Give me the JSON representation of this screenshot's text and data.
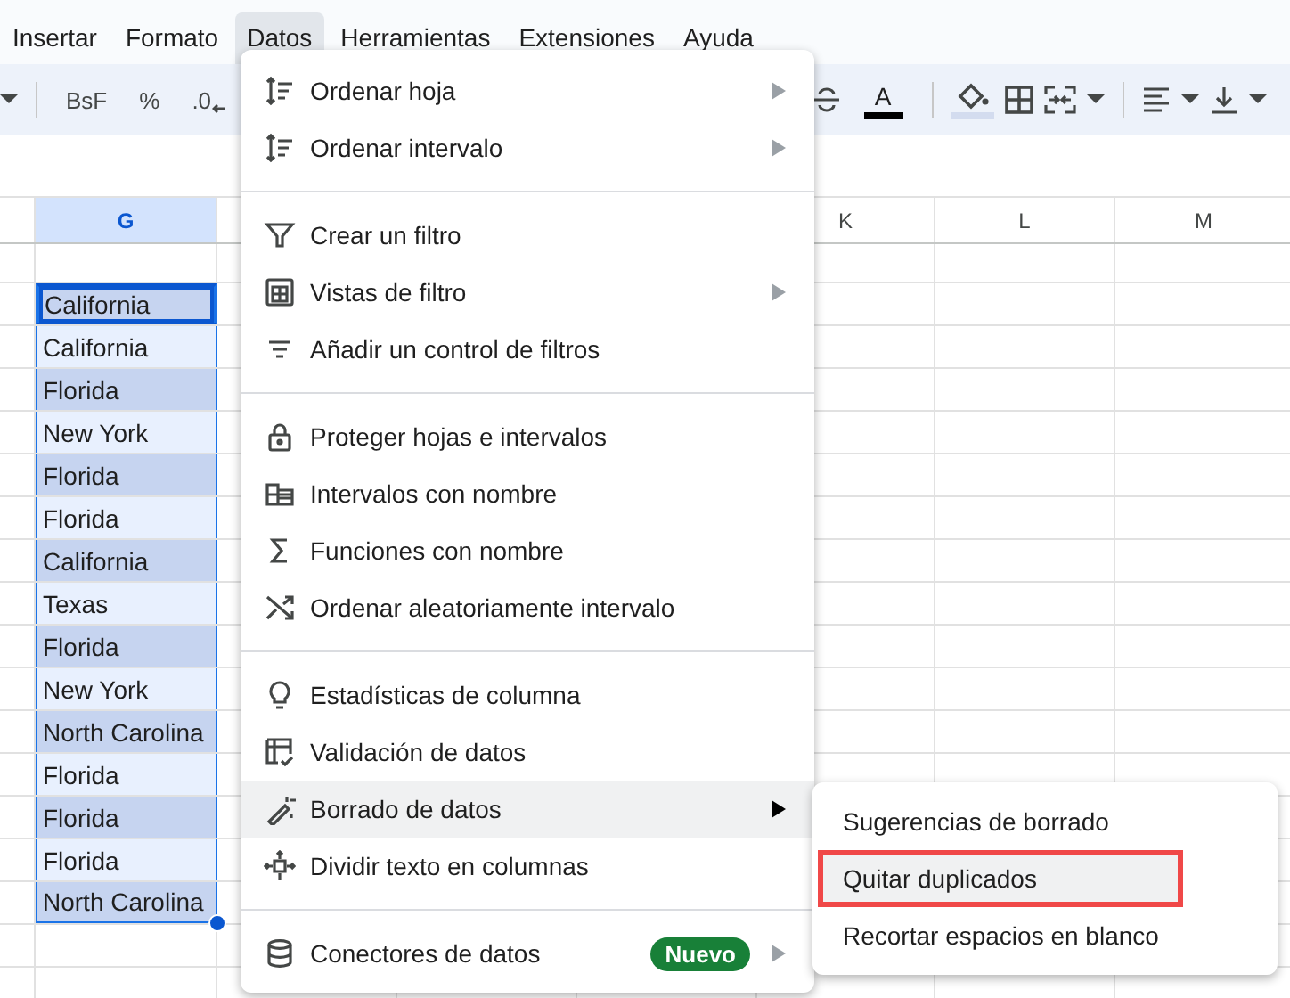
{
  "menu_bar": [
    {
      "label": "Insertar",
      "selected": false
    },
    {
      "label": "Formato",
      "selected": false
    },
    {
      "label": "Datos",
      "selected": true
    },
    {
      "label": "Herramientas",
      "selected": false
    },
    {
      "label": "Extensiones",
      "selected": false
    },
    {
      "label": "Ayuda",
      "selected": false
    }
  ],
  "toolbar_left": [
    {
      "kind": "caret"
    },
    {
      "kind": "divider"
    },
    {
      "kind": "text",
      "label": "BsF"
    },
    {
      "kind": "text",
      "label": "%"
    },
    {
      "kind": "decimal",
      "label": ".0"
    }
  ],
  "toolbar_right": [
    {
      "kind": "strikethrough"
    },
    {
      "kind": "text-color",
      "label": "A"
    },
    {
      "kind": "divider"
    },
    {
      "kind": "fill"
    },
    {
      "kind": "borders"
    },
    {
      "kind": "merge"
    },
    {
      "kind": "caret"
    },
    {
      "kind": "divider"
    },
    {
      "kind": "align"
    },
    {
      "kind": "caret"
    },
    {
      "kind": "valign"
    },
    {
      "kind": "caret"
    }
  ],
  "column_headers": [
    {
      "label": "G",
      "selected": true
    },
    {
      "label": "K",
      "selected": false
    },
    {
      "label": "L",
      "selected": false
    },
    {
      "label": "M",
      "selected": false
    }
  ],
  "cells": [
    {
      "text": "California",
      "active": true
    },
    {
      "text": "California",
      "active": false
    },
    {
      "text": "Florida",
      "active": false
    },
    {
      "text": "New York",
      "active": false
    },
    {
      "text": "Florida",
      "active": false
    },
    {
      "text": "Florida",
      "active": false
    },
    {
      "text": "California",
      "active": false
    },
    {
      "text": "Texas",
      "active": false
    },
    {
      "text": "Florida",
      "active": false
    },
    {
      "text": "New York",
      "active": false
    },
    {
      "text": "North Carolina",
      "active": false
    },
    {
      "text": "Florida",
      "active": false
    },
    {
      "text": "Florida",
      "active": false
    },
    {
      "text": "Florida",
      "active": false
    },
    {
      "text": "North Carolina",
      "active": false
    }
  ],
  "data_menu": {
    "groups": [
      [
        {
          "label": "Ordenar hoja",
          "submenu": true,
          "hovered": false
        },
        {
          "label": "Ordenar intervalo",
          "submenu": true,
          "hovered": false
        }
      ],
      [
        {
          "label": "Crear un filtro",
          "submenu": false,
          "hovered": false
        },
        {
          "label": "Vistas de filtro",
          "submenu": true,
          "hovered": false
        },
        {
          "label": "Añadir un control de filtros",
          "submenu": false,
          "hovered": false
        }
      ],
      [
        {
          "label": "Proteger hojas e intervalos",
          "submenu": false,
          "hovered": false
        },
        {
          "label": "Intervalos con nombre",
          "submenu": false,
          "hovered": false
        },
        {
          "label": "Funciones con nombre",
          "submenu": false,
          "hovered": false
        },
        {
          "label": "Ordenar aleatoriamente intervalo",
          "submenu": false,
          "hovered": false
        }
      ],
      [
        {
          "label": "Estadísticas de columna",
          "submenu": false,
          "hovered": false
        },
        {
          "label": "Validación de datos",
          "submenu": false,
          "hovered": false
        },
        {
          "label": "Borrado de datos",
          "submenu": true,
          "hovered": true
        },
        {
          "label": "Dividir texto en columnas",
          "submenu": false,
          "hovered": false
        }
      ],
      [
        {
          "label": "Conectores de datos",
          "submenu": true,
          "hovered": false,
          "badge": "Nuevo"
        }
      ]
    ]
  },
  "submenu": [
    {
      "label": "Sugerencias de borrado",
      "hovered": false,
      "highlighted": false
    },
    {
      "label": "Quitar duplicados",
      "hovered": true,
      "highlighted": true
    },
    {
      "label": "Recortar espacios en blanco",
      "hovered": false,
      "highlighted": false
    }
  ]
}
